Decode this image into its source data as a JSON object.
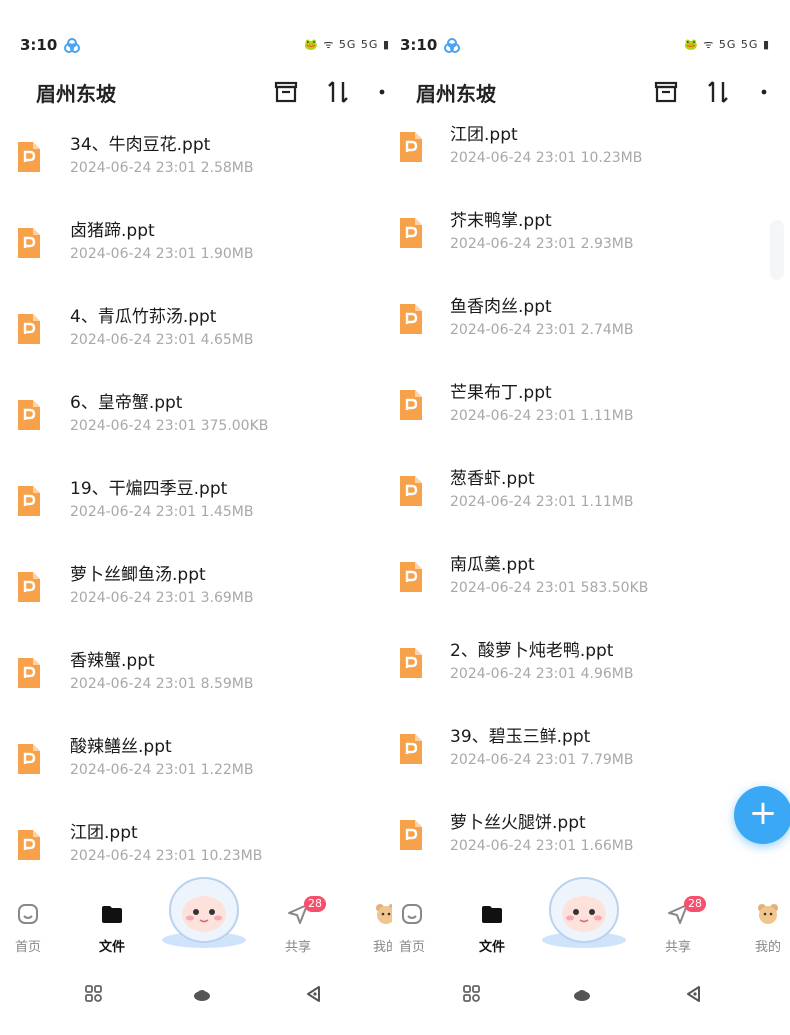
{
  "panels": [
    {
      "status": {
        "time": "3:10",
        "indicators": "🐸 ᯤ 5G 5G ▮"
      },
      "header": {
        "title": "眉州东坡"
      },
      "files": [
        {
          "name": "34、牛肉豆花.ppt",
          "meta": "2024-06-24  23:01   2.58MB"
        },
        {
          "name": "卤猪蹄.ppt",
          "meta": "2024-06-24  23:01   1.90MB"
        },
        {
          "name": "4、青瓜竹荪汤.ppt",
          "meta": "2024-06-24  23:01   4.65MB"
        },
        {
          "name": "6、皇帝蟹.ppt",
          "meta": "2024-06-24  23:01   375.00KB"
        },
        {
          "name": "19、干煸四季豆.ppt",
          "meta": "2024-06-24  23:01   1.45MB"
        },
        {
          "name": "萝卜丝鲫鱼汤.ppt",
          "meta": "2024-06-24  23:01   3.69MB"
        },
        {
          "name": "香辣蟹.ppt",
          "meta": "2024-06-24  23:01   8.59MB"
        },
        {
          "name": "酸辣鳝丝.ppt",
          "meta": "2024-06-24  23:01   1.22MB"
        },
        {
          "name": "江团.ppt",
          "meta": "2024-06-24  23:01   10.23MB"
        }
      ],
      "nav": {
        "home": "首页",
        "files": "文件",
        "share": "共享",
        "me": "我的",
        "badge": "28"
      }
    },
    {
      "status": {
        "time": "3:10",
        "indicators": "🐸 ᯤ 5G 5G ▮"
      },
      "header": {
        "title": "眉州东坡"
      },
      "files": [
        {
          "name": "江团.ppt",
          "meta": "2024-06-24  23:01   10.23MB"
        },
        {
          "name": "芥末鸭掌.ppt",
          "meta": "2024-06-24  23:01   2.93MB"
        },
        {
          "name": "鱼香肉丝.ppt",
          "meta": "2024-06-24  23:01   2.74MB"
        },
        {
          "name": "芒果布丁.ppt",
          "meta": "2024-06-24  23:01   1.11MB"
        },
        {
          "name": "葱香虾.ppt",
          "meta": "2024-06-24  23:01   1.11MB"
        },
        {
          "name": "南瓜羹.ppt",
          "meta": "2024-06-24  23:01   583.50KB"
        },
        {
          "name": "2、酸萝卜炖老鸭.ppt",
          "meta": "2024-06-24  23:01   4.96MB"
        },
        {
          "name": "39、碧玉三鲜.ppt",
          "meta": "2024-06-24  23:01   7.79MB"
        },
        {
          "name": "萝卜丝火腿饼.ppt",
          "meta": "2024-06-24  23:01   1.66MB"
        }
      ],
      "nav": {
        "home": "首页",
        "files": "文件",
        "share": "共享",
        "me": "我的",
        "badge": "28"
      }
    }
  ],
  "fab": {
    "label": "+"
  },
  "colors": {
    "file_icon": "#f7a14a",
    "accent": "#3aa8f5",
    "badge": "#f5506e"
  }
}
